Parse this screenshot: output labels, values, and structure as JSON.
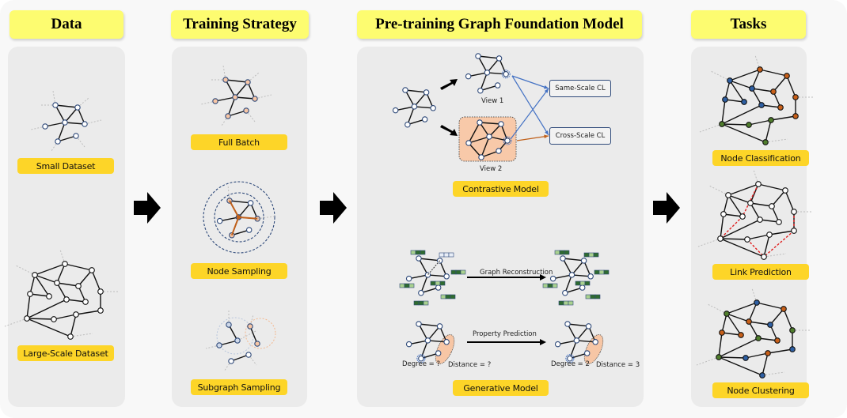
{
  "columns": [
    {
      "title": "Data"
    },
    {
      "title": "Training Strategy"
    },
    {
      "title": "Pre-training Graph Foundation Model"
    },
    {
      "title": "Tasks"
    }
  ],
  "data_panel": {
    "small_dataset": "Small Dataset",
    "large_dataset": "Large-Scale Dataset"
  },
  "training_panel": {
    "full_batch": "Full Batch",
    "node_sampling": "Node Sampling",
    "subgraph_sampling": "Subgraph Sampling"
  },
  "model_panel": {
    "view1": "View 1",
    "view2": "View 2",
    "same_scale_cl": "Same-Scale CL",
    "cross_scale_cl": "Cross-Scale CL",
    "contrastive_model": "Contrastive Model",
    "graph_reconstruction": "Graph Reconstruction",
    "property_prediction": "Property Prediction",
    "degree_unknown": "Degree = ?",
    "distance_unknown": "Distance = ?",
    "degree_known": "Degree = 2",
    "distance_known": "Distance = 3",
    "generative_model": "Generative Model"
  },
  "tasks_panel": {
    "node_classification": "Node Classification",
    "link_prediction": "Link Prediction",
    "node_clustering": "Node Clustering"
  },
  "colors": {
    "title_bg": "#fdfc70",
    "tag_bg": "#fdd528",
    "panel_bg": "#ebebeb",
    "node_outline": "#2f4a7a",
    "orange_accent": "#c0601a",
    "peach": "#f7c6a5",
    "blue_arrow": "#4472c4",
    "class_blue": "#2e5fa3",
    "class_orange": "#c8601a",
    "class_green": "#4f7d2c",
    "link_red": "#e02020",
    "feat_dark": "#2f6b2f",
    "feat_light": "#a9d18e"
  }
}
